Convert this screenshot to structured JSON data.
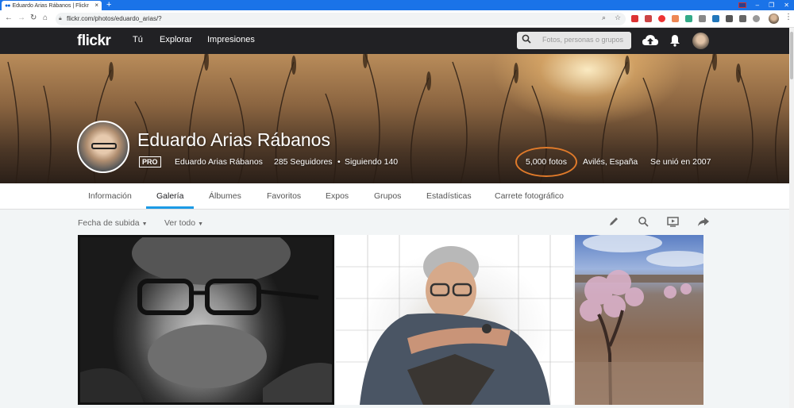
{
  "browser": {
    "tab_title": "Eduardo Arias Rábanos | Flickr",
    "new_tab": "+",
    "url": "flickr.com/photos/eduardo_arias/?"
  },
  "header": {
    "logo": "flickr",
    "nav": [
      "Tú",
      "Explorar",
      "Impresiones"
    ],
    "search_placeholder": "Fotos, personas o grupos"
  },
  "profile": {
    "name": "Eduardo Arias Rábanos",
    "badge": "PRO",
    "username": "Eduardo Arias Rábanos",
    "followers": "285 Seguidores",
    "following": "Siguiendo 140",
    "photos": "5,000 fotos",
    "location": "Avilés, España",
    "joined": "Se unió en 2007"
  },
  "subnav": {
    "tabs": [
      "Información",
      "Galería",
      "Álbumes",
      "Favoritos",
      "Expos",
      "Grupos",
      "Estadísticas",
      "Carrete fotográfico"
    ],
    "active": "Galería"
  },
  "toolbar": {
    "sort": "Fecha de subida",
    "view": "Ver todo"
  },
  "colors": {
    "header_bg": "#212124",
    "active_tab": "#1c9be6",
    "annotation_circle": "#e07a2a",
    "browser_tabbar": "#1a73e8"
  }
}
